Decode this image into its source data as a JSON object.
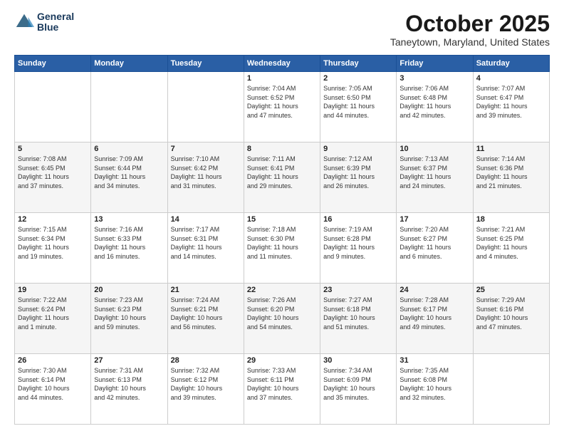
{
  "header": {
    "logo": {
      "line1": "General",
      "line2": "Blue"
    },
    "title": "October 2025",
    "location": "Taneytown, Maryland, United States"
  },
  "weekdays": [
    "Sunday",
    "Monday",
    "Tuesday",
    "Wednesday",
    "Thursday",
    "Friday",
    "Saturday"
  ],
  "weeks": [
    [
      {
        "day": "",
        "info": ""
      },
      {
        "day": "",
        "info": ""
      },
      {
        "day": "",
        "info": ""
      },
      {
        "day": "1",
        "info": "Sunrise: 7:04 AM\nSunset: 6:52 PM\nDaylight: 11 hours\nand 47 minutes."
      },
      {
        "day": "2",
        "info": "Sunrise: 7:05 AM\nSunset: 6:50 PM\nDaylight: 11 hours\nand 44 minutes."
      },
      {
        "day": "3",
        "info": "Sunrise: 7:06 AM\nSunset: 6:48 PM\nDaylight: 11 hours\nand 42 minutes."
      },
      {
        "day": "4",
        "info": "Sunrise: 7:07 AM\nSunset: 6:47 PM\nDaylight: 11 hours\nand 39 minutes."
      }
    ],
    [
      {
        "day": "5",
        "info": "Sunrise: 7:08 AM\nSunset: 6:45 PM\nDaylight: 11 hours\nand 37 minutes."
      },
      {
        "day": "6",
        "info": "Sunrise: 7:09 AM\nSunset: 6:44 PM\nDaylight: 11 hours\nand 34 minutes."
      },
      {
        "day": "7",
        "info": "Sunrise: 7:10 AM\nSunset: 6:42 PM\nDaylight: 11 hours\nand 31 minutes."
      },
      {
        "day": "8",
        "info": "Sunrise: 7:11 AM\nSunset: 6:41 PM\nDaylight: 11 hours\nand 29 minutes."
      },
      {
        "day": "9",
        "info": "Sunrise: 7:12 AM\nSunset: 6:39 PM\nDaylight: 11 hours\nand 26 minutes."
      },
      {
        "day": "10",
        "info": "Sunrise: 7:13 AM\nSunset: 6:37 PM\nDaylight: 11 hours\nand 24 minutes."
      },
      {
        "day": "11",
        "info": "Sunrise: 7:14 AM\nSunset: 6:36 PM\nDaylight: 11 hours\nand 21 minutes."
      }
    ],
    [
      {
        "day": "12",
        "info": "Sunrise: 7:15 AM\nSunset: 6:34 PM\nDaylight: 11 hours\nand 19 minutes."
      },
      {
        "day": "13",
        "info": "Sunrise: 7:16 AM\nSunset: 6:33 PM\nDaylight: 11 hours\nand 16 minutes."
      },
      {
        "day": "14",
        "info": "Sunrise: 7:17 AM\nSunset: 6:31 PM\nDaylight: 11 hours\nand 14 minutes."
      },
      {
        "day": "15",
        "info": "Sunrise: 7:18 AM\nSunset: 6:30 PM\nDaylight: 11 hours\nand 11 minutes."
      },
      {
        "day": "16",
        "info": "Sunrise: 7:19 AM\nSunset: 6:28 PM\nDaylight: 11 hours\nand 9 minutes."
      },
      {
        "day": "17",
        "info": "Sunrise: 7:20 AM\nSunset: 6:27 PM\nDaylight: 11 hours\nand 6 minutes."
      },
      {
        "day": "18",
        "info": "Sunrise: 7:21 AM\nSunset: 6:25 PM\nDaylight: 11 hours\nand 4 minutes."
      }
    ],
    [
      {
        "day": "19",
        "info": "Sunrise: 7:22 AM\nSunset: 6:24 PM\nDaylight: 11 hours\nand 1 minute."
      },
      {
        "day": "20",
        "info": "Sunrise: 7:23 AM\nSunset: 6:23 PM\nDaylight: 10 hours\nand 59 minutes."
      },
      {
        "day": "21",
        "info": "Sunrise: 7:24 AM\nSunset: 6:21 PM\nDaylight: 10 hours\nand 56 minutes."
      },
      {
        "day": "22",
        "info": "Sunrise: 7:26 AM\nSunset: 6:20 PM\nDaylight: 10 hours\nand 54 minutes."
      },
      {
        "day": "23",
        "info": "Sunrise: 7:27 AM\nSunset: 6:18 PM\nDaylight: 10 hours\nand 51 minutes."
      },
      {
        "day": "24",
        "info": "Sunrise: 7:28 AM\nSunset: 6:17 PM\nDaylight: 10 hours\nand 49 minutes."
      },
      {
        "day": "25",
        "info": "Sunrise: 7:29 AM\nSunset: 6:16 PM\nDaylight: 10 hours\nand 47 minutes."
      }
    ],
    [
      {
        "day": "26",
        "info": "Sunrise: 7:30 AM\nSunset: 6:14 PM\nDaylight: 10 hours\nand 44 minutes."
      },
      {
        "day": "27",
        "info": "Sunrise: 7:31 AM\nSunset: 6:13 PM\nDaylight: 10 hours\nand 42 minutes."
      },
      {
        "day": "28",
        "info": "Sunrise: 7:32 AM\nSunset: 6:12 PM\nDaylight: 10 hours\nand 39 minutes."
      },
      {
        "day": "29",
        "info": "Sunrise: 7:33 AM\nSunset: 6:11 PM\nDaylight: 10 hours\nand 37 minutes."
      },
      {
        "day": "30",
        "info": "Sunrise: 7:34 AM\nSunset: 6:09 PM\nDaylight: 10 hours\nand 35 minutes."
      },
      {
        "day": "31",
        "info": "Sunrise: 7:35 AM\nSunset: 6:08 PM\nDaylight: 10 hours\nand 32 minutes."
      },
      {
        "day": "",
        "info": ""
      }
    ]
  ]
}
